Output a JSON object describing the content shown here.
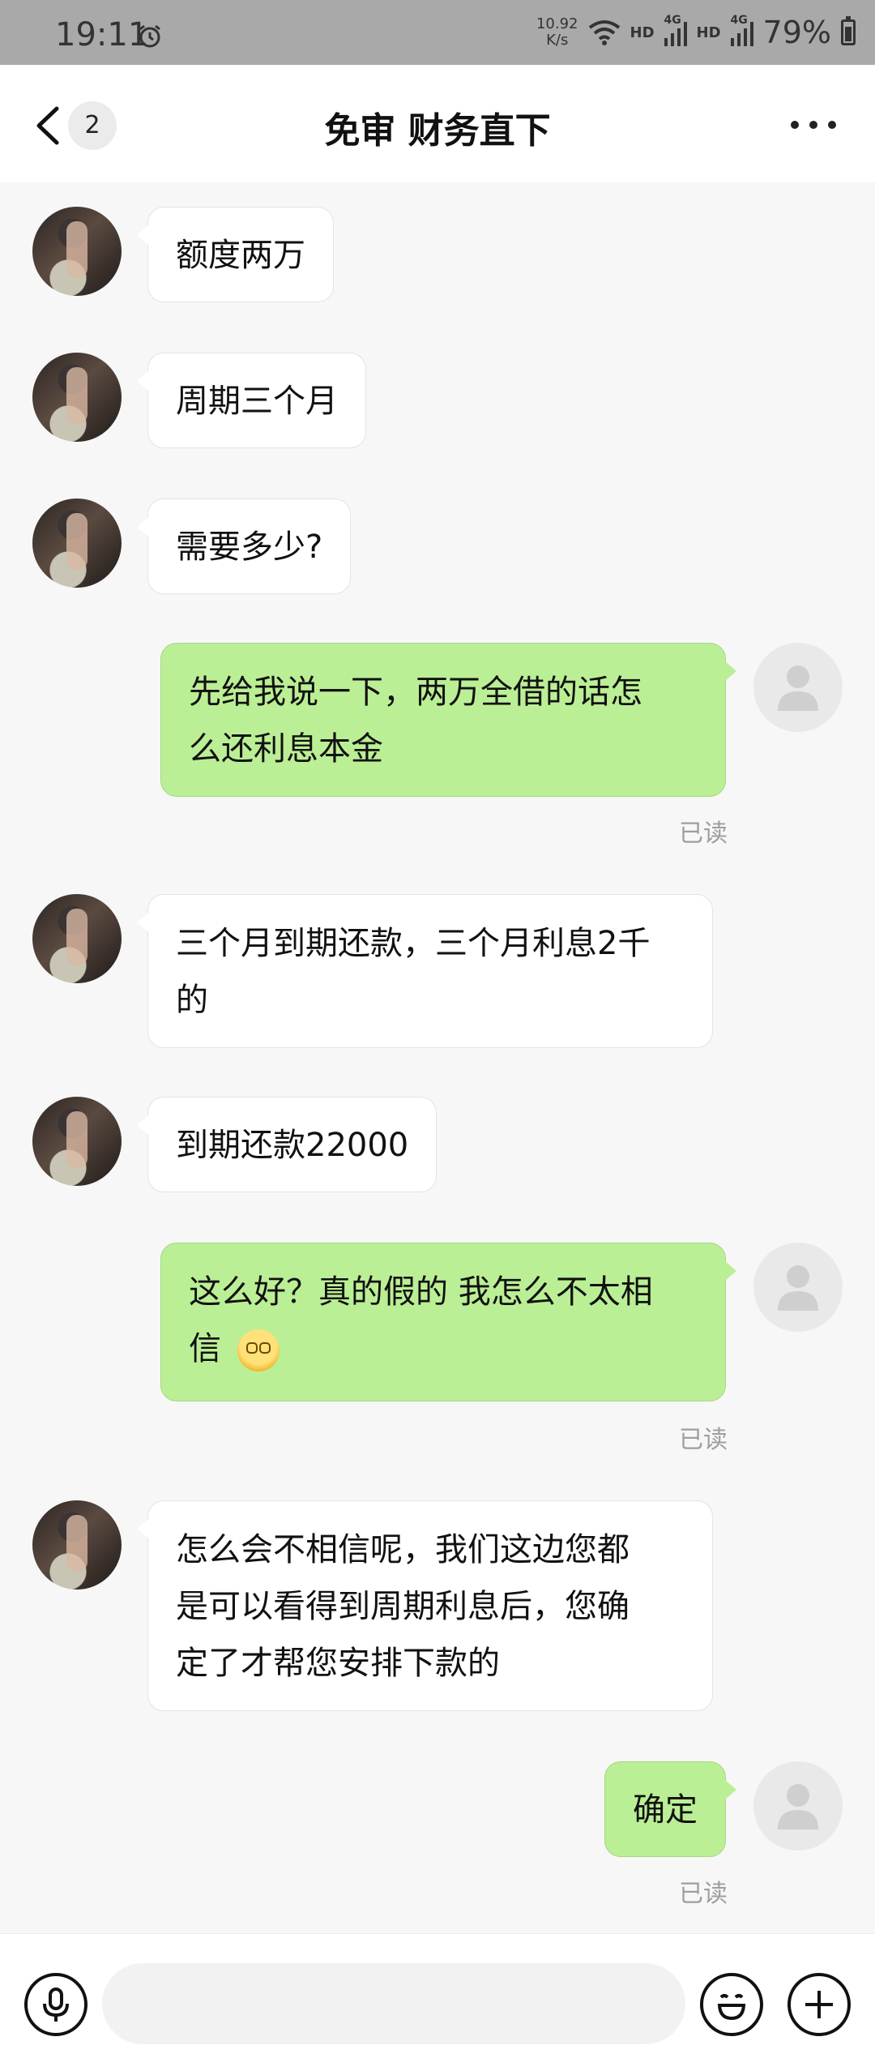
{
  "status_bar": {
    "time": "19:11",
    "net_speed_value": "10.92",
    "net_speed_unit": "K/s",
    "hd_label_1": "HD",
    "hd_label_2": "HD",
    "net_type_1": "4G",
    "net_type_2": "4G",
    "battery": "79%",
    "icons": [
      "alarm-icon",
      "wifi-icon",
      "signal-icon",
      "battery-icon"
    ]
  },
  "header": {
    "back_icon": "chevron-left-icon",
    "unread_count": "2",
    "title": "免审 财务直下",
    "more_icon": "more-dots-icon"
  },
  "messages": [
    {
      "from": "them",
      "lines": [
        "额度两万"
      ]
    },
    {
      "from": "them",
      "lines": [
        "周期三个月"
      ]
    },
    {
      "from": "them",
      "lines": [
        "需要多少?"
      ]
    },
    {
      "from": "me",
      "lines": [
        "先给我说一下，两万全借的话怎",
        "么还利息本金"
      ],
      "status": "已读"
    },
    {
      "from": "them",
      "lines": [
        "三个月到期还款，三个月利息2千",
        "的"
      ]
    },
    {
      "from": "them",
      "lines": [
        "到期还款22000"
      ]
    },
    {
      "from": "me",
      "lines": [
        "这么好？真的假的  我怎么不太相",
        "信"
      ],
      "emoji": "dizzy-face-emoji",
      "status": "已读"
    },
    {
      "from": "them",
      "lines": [
        "怎么会不相信呢，我们这边您都",
        "是可以看得到周期利息后，您确",
        "定了才帮您安排下款的"
      ]
    },
    {
      "from": "me",
      "lines": [
        "确定"
      ],
      "status": "已读"
    }
  ],
  "input_bar": {
    "placeholder": "",
    "icons": [
      "microphone-icon",
      "emoji-icon",
      "plus-icon"
    ]
  },
  "colors": {
    "my_bubble": "#bbef95",
    "their_bubble": "#ffffff",
    "background": "#f7f7f7",
    "status_bar": "#a9a9a9"
  }
}
